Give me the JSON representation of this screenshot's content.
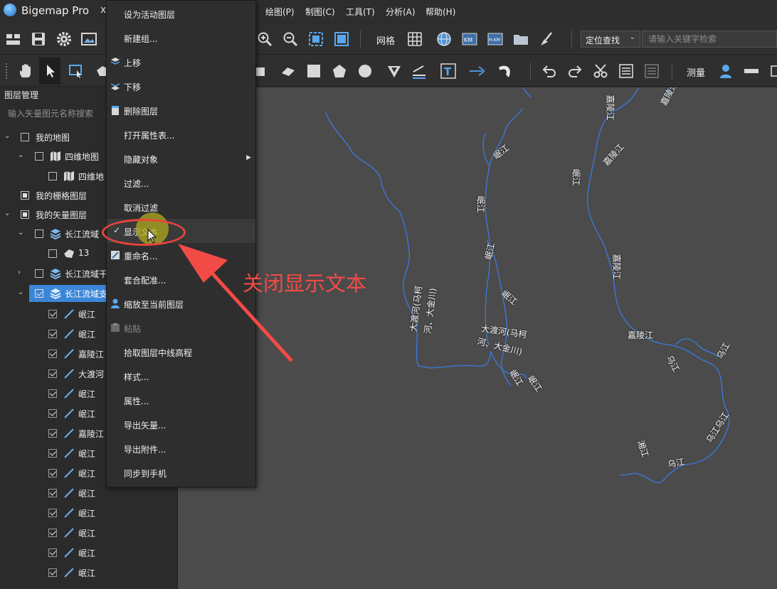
{
  "app": {
    "title": "Bigemap Pro",
    "close_glyph": "x"
  },
  "menubar": {
    "items": [
      {
        "label": "绘图(P)"
      },
      {
        "label": "制图(C)"
      },
      {
        "label": "工具(T)"
      },
      {
        "label": "分析(A)"
      },
      {
        "label": "帮助(H)"
      }
    ]
  },
  "toolbar1": {
    "grid_label": "网格",
    "search_mode": "定位查找",
    "search_placeholder": "请输入关键字检索",
    "icons": [
      "layers-panel-icon",
      "save-icon",
      "settings-icon",
      "image-icon",
      "zoom-in-icon",
      "zoom-out-icon",
      "zoom-extent-icon",
      "full-extent-icon",
      "grid-icon",
      "lnglat-icon",
      "km-grid-icon",
      "hkm-grid-icon",
      "folder-icon",
      "clear-icon"
    ]
  },
  "toolbar2": {
    "measure_label": "测量",
    "icons": [
      "pan-icon",
      "select-icon",
      "select-rect-icon",
      "rectangle-icon",
      "polyline-icon",
      "square-icon",
      "pentagon-icon",
      "circle-icon",
      "marker-icon",
      "line-style-icon",
      "text-icon",
      "arrow-icon",
      "curve-icon",
      "undo-icon",
      "redo-icon",
      "cut-icon",
      "attribute-icon",
      "attribute2-icon",
      "location-icon",
      "ruler-icon"
    ]
  },
  "layer_panel": {
    "title": "图层管理",
    "search_placeholder": "输入矢量图元名称搜索",
    "rows": [
      {
        "label": "我的地图"
      },
      {
        "label": "四维地图"
      },
      {
        "label": "四维地"
      },
      {
        "label": "我的栅格图层"
      },
      {
        "label": "我的矢量图层"
      },
      {
        "label": "长江流域"
      },
      {
        "label": "13"
      },
      {
        "label": "长江流域干"
      },
      {
        "label": "长江流域支"
      },
      {
        "label": "岷江"
      },
      {
        "label": "岷江"
      },
      {
        "label": "嘉陵江"
      },
      {
        "label": "大渡河"
      },
      {
        "label": "岷江"
      },
      {
        "label": "岷江"
      },
      {
        "label": "嘉陵江"
      },
      {
        "label": "岷江"
      },
      {
        "label": "岷江"
      },
      {
        "label": "岷江"
      },
      {
        "label": "岷江"
      },
      {
        "label": "岷江"
      },
      {
        "label": "岷江"
      },
      {
        "label": "岷江"
      }
    ]
  },
  "context_menu": {
    "items": [
      {
        "label": "设为活动图层"
      },
      {
        "label": "新建组..."
      },
      {
        "label": "上移",
        "icon": "move-up-icon"
      },
      {
        "label": "下移",
        "icon": "move-down-icon"
      },
      {
        "label": "删除图层",
        "icon": "delete-layer-icon"
      },
      {
        "label": "打开属性表..."
      },
      {
        "label": "隐藏对象",
        "submenu": "▶"
      },
      {
        "label": "过滤..."
      },
      {
        "label": "取消过滤"
      },
      {
        "label": "显示文本",
        "check": "✓"
      },
      {
        "label": "重命名...",
        "icon": "rename-icon"
      },
      {
        "label": "套合配准..."
      },
      {
        "label": "缩放至当前图层",
        "icon": "zoom-layer-icon"
      },
      {
        "label": "粘贴",
        "icon": "paste-icon",
        "disabled": true
      },
      {
        "label": "拾取图层中线高程"
      },
      {
        "label": "样式..."
      },
      {
        "label": "属性..."
      },
      {
        "label": "导出矢量..."
      },
      {
        "label": "导出附件..."
      },
      {
        "label": "同步到手机"
      }
    ]
  },
  "annotation": {
    "text": "关闭显示文本",
    "color": "#f24b46"
  },
  "map": {
    "labels": [
      {
        "text": "岷江"
      },
      {
        "text": "嘉陵江"
      },
      {
        "text": "嘉陵江"
      },
      {
        "text": "岷江"
      },
      {
        "text": "嘉陵江"
      },
      {
        "text": "岷江"
      },
      {
        "text": "嘉陵江"
      },
      {
        "text": "岷江"
      },
      {
        "text": "大渡河(马柯"
      },
      {
        "text": "河、大金川)"
      },
      {
        "text": "大渡河(马柯"
      },
      {
        "text": "河、大金川)"
      },
      {
        "text": "嘉陵江"
      },
      {
        "text": "岷江"
      },
      {
        "text": "岷江"
      },
      {
        "text": "乌江"
      },
      {
        "text": "乌江"
      },
      {
        "text": "乌江乌江"
      },
      {
        "text": "湘江"
      },
      {
        "text": "乌江"
      },
      {
        "text": "岷江"
      }
    ]
  },
  "colors": {
    "map_bg": "#4b4b4b",
    "river": "#3a7be0",
    "selection": "#3b86d6",
    "panel_bg": "#2b2b2b"
  }
}
